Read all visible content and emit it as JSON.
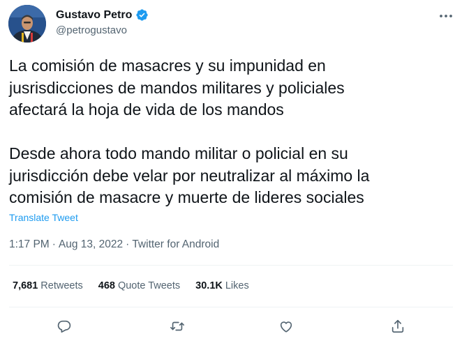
{
  "author": {
    "display_name": "Gustavo Petro",
    "handle": "@petrogustavo",
    "avatar_icon": "profile-photo",
    "verified_icon": "verified-badge-icon",
    "verified_color": "#1d9bf0"
  },
  "more_icon": "more-horizontal-icon",
  "tweet": {
    "paragraph_1": [
      "La comisión de masacres y su impunidad en",
      "jusrisdicciones de mandos militares y policiales",
      "afectará la hoja de vida de los mandos"
    ],
    "paragraph_2": [
      "Desde ahora todo mando militar o policial en su",
      "jurisdicción debe velar por neutralizar al máximo la",
      "comisión de masacre y muerte de lideres sociales"
    ],
    "translate_label": "Translate Tweet"
  },
  "meta": {
    "time": "1:17 PM",
    "separator": "·",
    "date": "Aug 13, 2022",
    "source": "Twitter for Android"
  },
  "stats": {
    "retweets_count": "7,681",
    "retweets_label": "Retweets",
    "quotes_count": "468",
    "quotes_label": "Quote Tweets",
    "likes_count": "30.1K",
    "likes_label": "Likes"
  },
  "actions": {
    "reply_icon": "reply-icon",
    "retweet_icon": "retweet-icon",
    "like_icon": "like-icon",
    "share_icon": "share-icon"
  },
  "colors": {
    "text_primary": "#0f1419",
    "text_secondary": "#536471",
    "link": "#1d9bf0",
    "divider": "#eff3f4"
  }
}
